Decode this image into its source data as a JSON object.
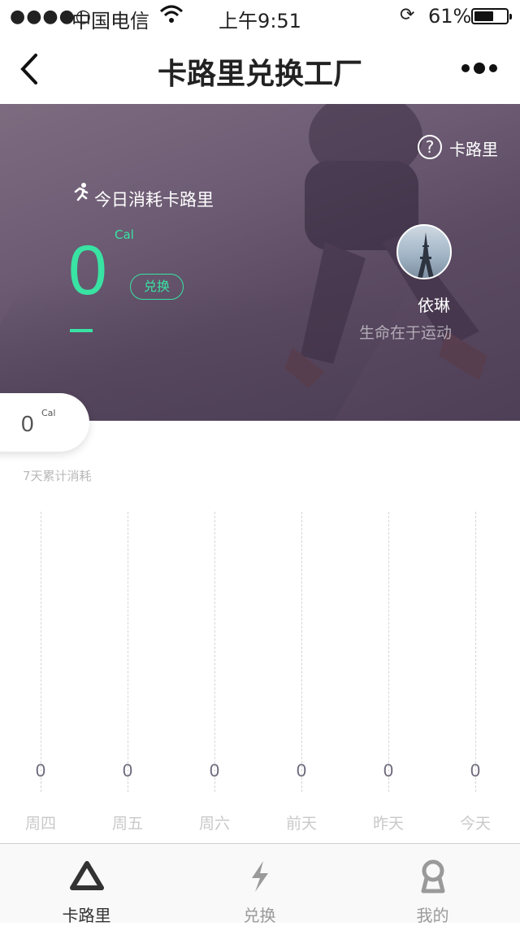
{
  "status": {
    "signal": "●●●●○",
    "carrier": "中国电信",
    "time": "上午9:51",
    "battery_pct": "61%",
    "battery_level": 0.61
  },
  "nav": {
    "title": "卡路里兑换工厂",
    "back_icon": "chevron-left-icon",
    "more_icon": "more-dots-icon"
  },
  "hero": {
    "help_label": "卡路里",
    "today_label": "今日消耗卡路里",
    "today_value": "0",
    "unit": "Cal",
    "exchange_label": "兑换",
    "user_name": "依琳",
    "motto": "生命在于运动",
    "accent_color": "#39e3a3"
  },
  "summary": {
    "value": "0",
    "unit": "Cal",
    "label": "7天累计消耗"
  },
  "chart_data": {
    "type": "bar",
    "categories": [
      "周四",
      "周五",
      "周六",
      "前天",
      "昨天",
      "今天"
    ],
    "values": [
      0,
      0,
      0,
      0,
      0,
      0
    ],
    "value_labels": [
      "0",
      "0",
      "0",
      "0",
      "0",
      "0"
    ]
  },
  "tabs": [
    {
      "label": "卡路里",
      "icon": "triangle-icon",
      "active": true
    },
    {
      "label": "兑换",
      "icon": "lightning-icon",
      "active": false
    },
    {
      "label": "我的",
      "icon": "profile-pin-icon",
      "active": false
    }
  ]
}
